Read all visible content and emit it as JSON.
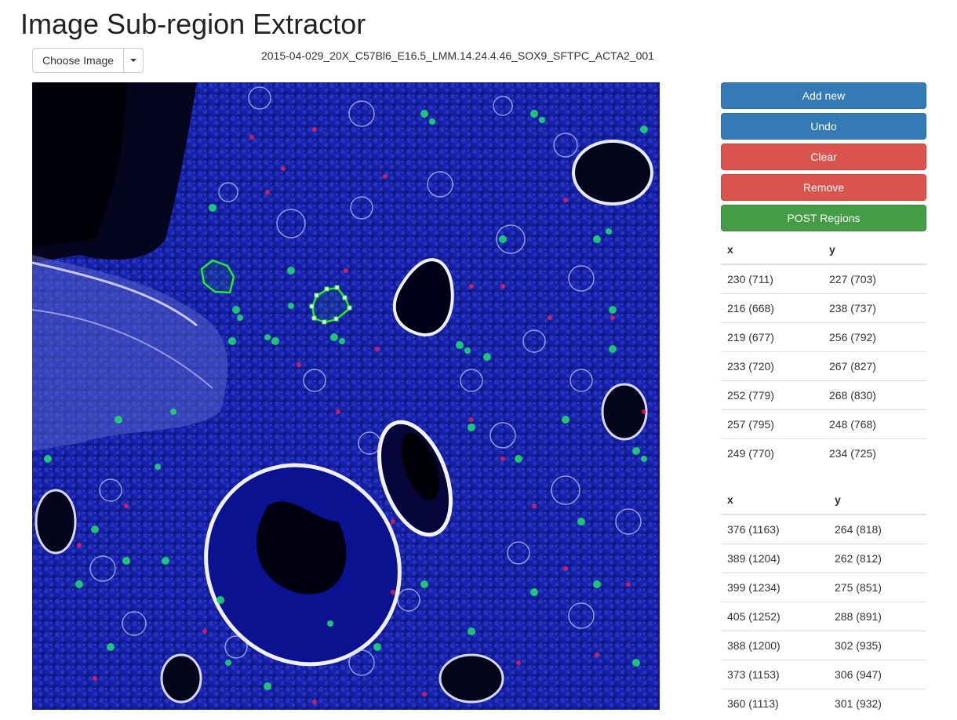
{
  "page": {
    "title": "Image Sub-region Extractor"
  },
  "toolbar": {
    "choose_image_label": "Choose Image"
  },
  "image": {
    "filename": "2015-04-029_20X_C57Bl6_E16.5_LMM.14.24.4.46_SOX9_SFTPC_ACTA2_001"
  },
  "actions": {
    "add_new": "Add new",
    "undo": "Undo",
    "clear": "Clear",
    "remove": "Remove",
    "post_regions": "POST Regions"
  },
  "colors": {
    "primary": "#337ab7",
    "danger": "#d9534f",
    "success": "#449d44",
    "region_outline": "#22ee22"
  },
  "regions": [
    {
      "headers": {
        "x": "x",
        "y": "y"
      },
      "rows": [
        {
          "x": "230 (711)",
          "y": "227 (703)"
        },
        {
          "x": "216 (668)",
          "y": "238 (737)"
        },
        {
          "x": "219 (677)",
          "y": "256 (792)"
        },
        {
          "x": "233 (720)",
          "y": "267 (827)"
        },
        {
          "x": "252 (779)",
          "y": "268 (830)"
        },
        {
          "x": "257 (795)",
          "y": "248 (768)"
        },
        {
          "x": "249 (770)",
          "y": "234 (725)"
        }
      ]
    },
    {
      "headers": {
        "x": "x",
        "y": "y"
      },
      "rows": [
        {
          "x": "376 (1163)",
          "y": "264 (818)"
        },
        {
          "x": "389 (1204)",
          "y": "262 (812)"
        },
        {
          "x": "399 (1234)",
          "y": "275 (851)"
        },
        {
          "x": "405 (1252)",
          "y": "288 (891)"
        },
        {
          "x": "388 (1200)",
          "y": "302 (935)"
        },
        {
          "x": "373 (1153)",
          "y": "306 (947)"
        },
        {
          "x": "360 (1113)",
          "y": "301 (932)"
        }
      ]
    }
  ]
}
